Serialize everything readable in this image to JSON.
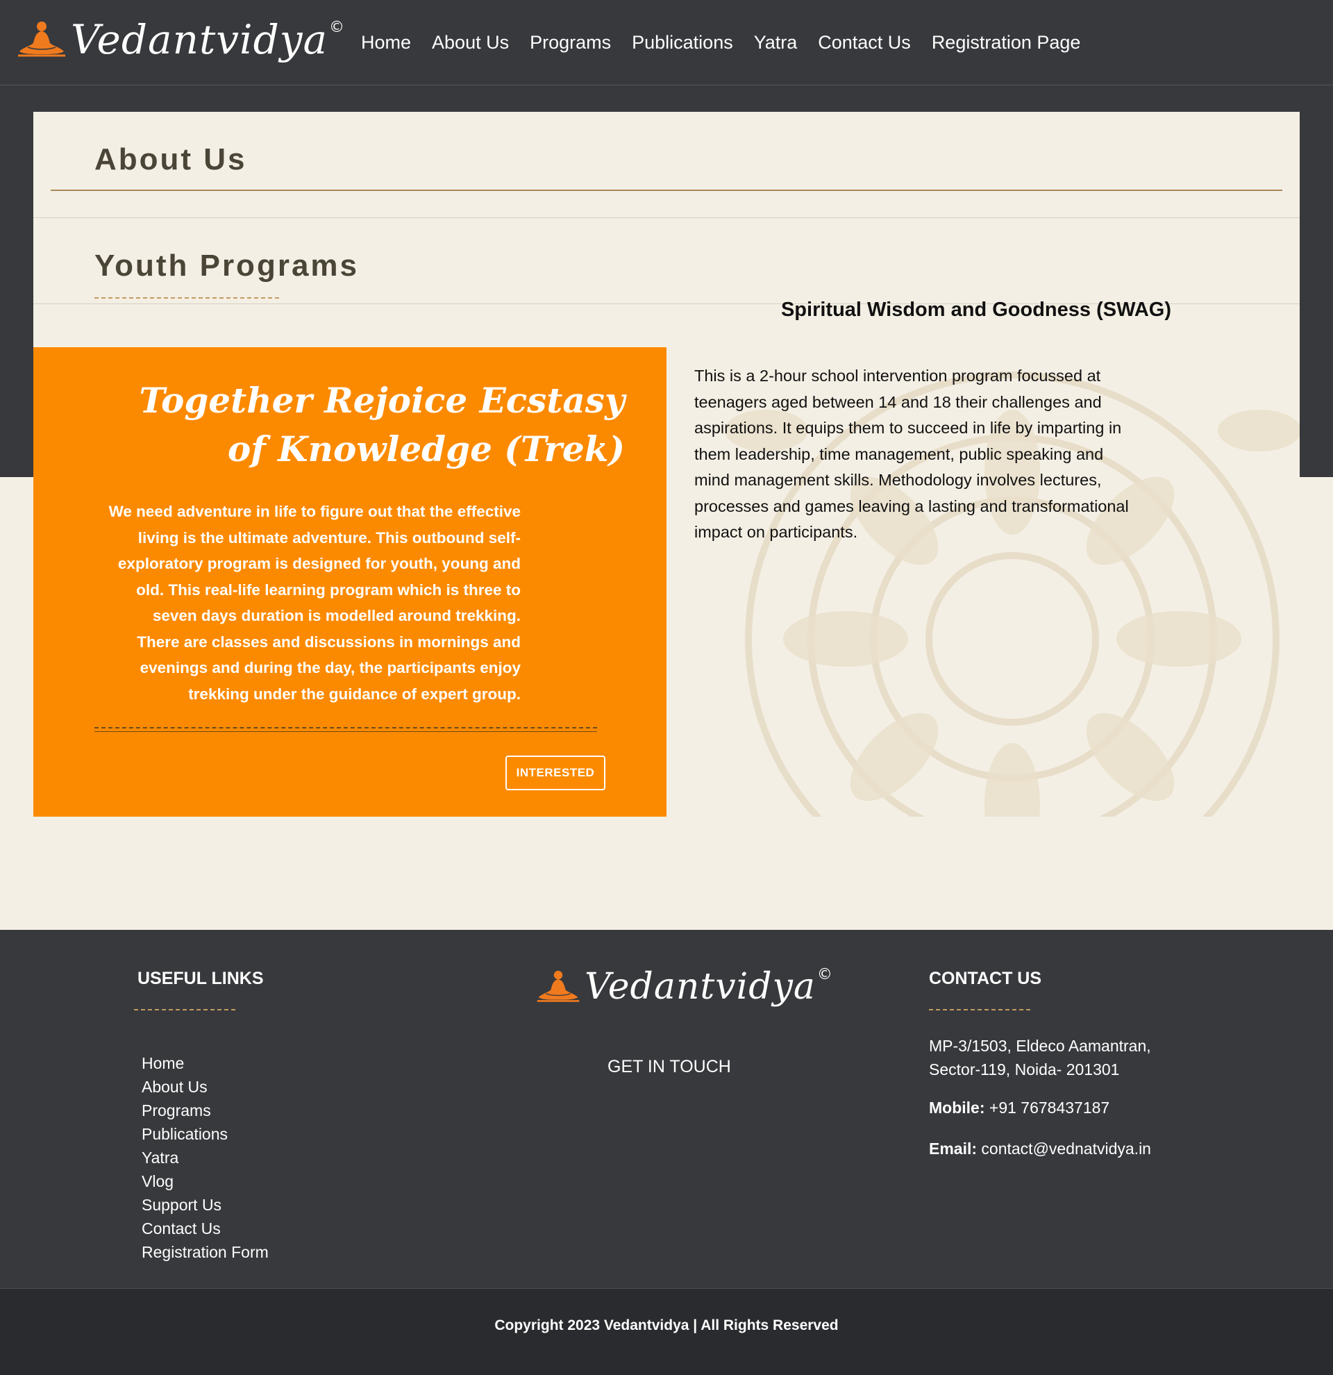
{
  "header": {
    "logo_text": "Vedantvidya",
    "logo_mark": "©",
    "nav": [
      "Home",
      "About Us",
      "Programs",
      "Publications",
      "Yatra",
      "Contact Us",
      "Registration Page"
    ]
  },
  "about": {
    "title": "About Us"
  },
  "youth": {
    "title": "Youth Programs"
  },
  "trek_card": {
    "title": "Together Rejoice Ecstasy of Knowledge (Trek)",
    "body": "We need adventure in life to figure out that the effective living is the ultimate adventure. This outbound self-exploratory program is designed for youth, young and old. This real-life learning program which is three to seven days duration is modelled around trekking. There are classes and discussions in mornings and evenings and during the day, the participants enjoy trekking under the guidance of expert group.",
    "button": "INTERESTED",
    "bg_color": "#fc8a00"
  },
  "swag": {
    "title": "Spiritual Wisdom and Goodness (SWAG)",
    "body": "This is a 2-hour school intervention program focussed at teenagers aged between 14 and 18 their challenges and aspirations. It equips them to succeed in life by imparting in them leadership, time management, public speaking and mind management skills. Methodology involves lectures, processes and games leaving a lasting and transformational impact on participants."
  },
  "footer": {
    "useful_links_title": "USEFUL LINKS",
    "links": [
      "Home",
      "About Us",
      "Programs",
      "Publications",
      "Yatra",
      "Vlog",
      "Support Us",
      "Contact Us",
      "Registration Form"
    ],
    "logo_text": "Vedantvidya",
    "logo_mark": "©",
    "get_in_touch": "GET IN TOUCH",
    "contact_title": "CONTACT US",
    "address_line1": "MP-3/1503, Eldeco Aamantran,",
    "address_line2": "Sector-119, Noida- 201301",
    "mobile_label": "Mobile:",
    "mobile": "+91 7678437187",
    "email_label": "Email:",
    "email": "contact@vednatvidya.in",
    "copyright": "Copyright 2023 Vedantvidya | All Rights Reserved"
  },
  "colors": {
    "dark": "#38393c",
    "cream": "#f4efe4",
    "orange": "#fc8a00",
    "accent": "#c49a62"
  }
}
